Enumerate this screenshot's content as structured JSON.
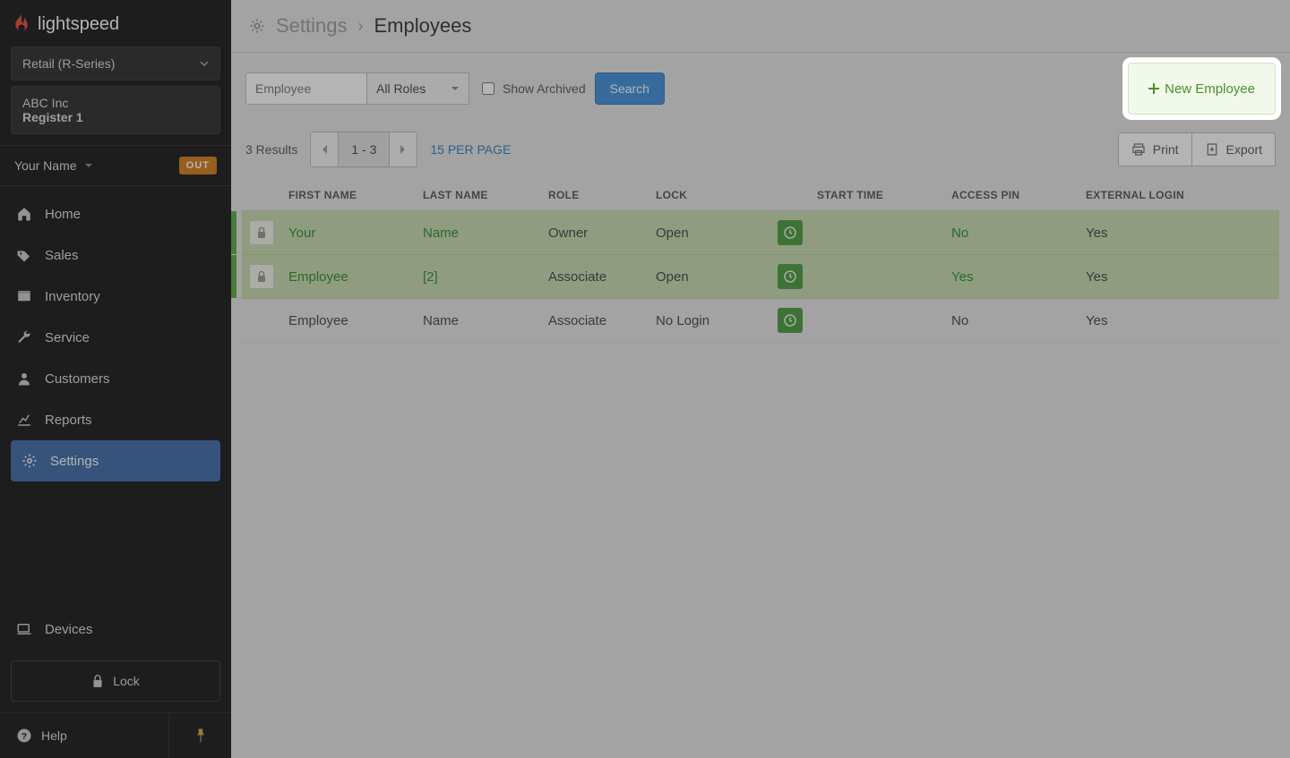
{
  "brand": "lightspeed",
  "shop_selector": {
    "label": "Retail (R-Series)"
  },
  "shop_context": {
    "company": "ABC Inc",
    "register": "Register 1"
  },
  "user": {
    "name": "Your Name",
    "status_badge": "OUT"
  },
  "nav": {
    "home": "Home",
    "sales": "Sales",
    "inventory": "Inventory",
    "service": "Service",
    "customers": "Customers",
    "reports": "Reports",
    "settings": "Settings",
    "devices": "Devices"
  },
  "sidebar_bottom": {
    "lock": "Lock",
    "help": "Help"
  },
  "breadcrumb": {
    "parent": "Settings",
    "current": "Employees"
  },
  "filters": {
    "search_placeholder": "Employee",
    "role_select": "All Roles",
    "show_archived": "Show Archived",
    "search_btn": "Search"
  },
  "new_employee_btn": "New Employee",
  "list": {
    "results": "3 Results",
    "page_range": "1 - 3",
    "per_page": "15 PER PAGE",
    "print": "Print",
    "export": "Export"
  },
  "table": {
    "headers": {
      "first": "FIRST NAME",
      "last": "LAST NAME",
      "role": "ROLE",
      "lock": "LOCK",
      "start": "START TIME",
      "pin": "ACCESS PIN",
      "ext": "EXTERNAL LOGIN"
    },
    "rows": [
      {
        "first": "Your",
        "last": "Name",
        "role": "Owner",
        "lock": "Open",
        "pin": "No",
        "ext": "Yes",
        "highlight": true,
        "locked": true,
        "link": true
      },
      {
        "first": "Employee",
        "last": "[2]",
        "role": "Associate",
        "lock": "Open",
        "pin": "Yes",
        "ext": "Yes",
        "highlight": true,
        "locked": true,
        "link": true
      },
      {
        "first": "Employee",
        "last": "Name",
        "role": "Associate",
        "lock": "No Login",
        "pin": "No",
        "ext": "Yes",
        "highlight": false,
        "locked": false,
        "link": false
      }
    ]
  }
}
